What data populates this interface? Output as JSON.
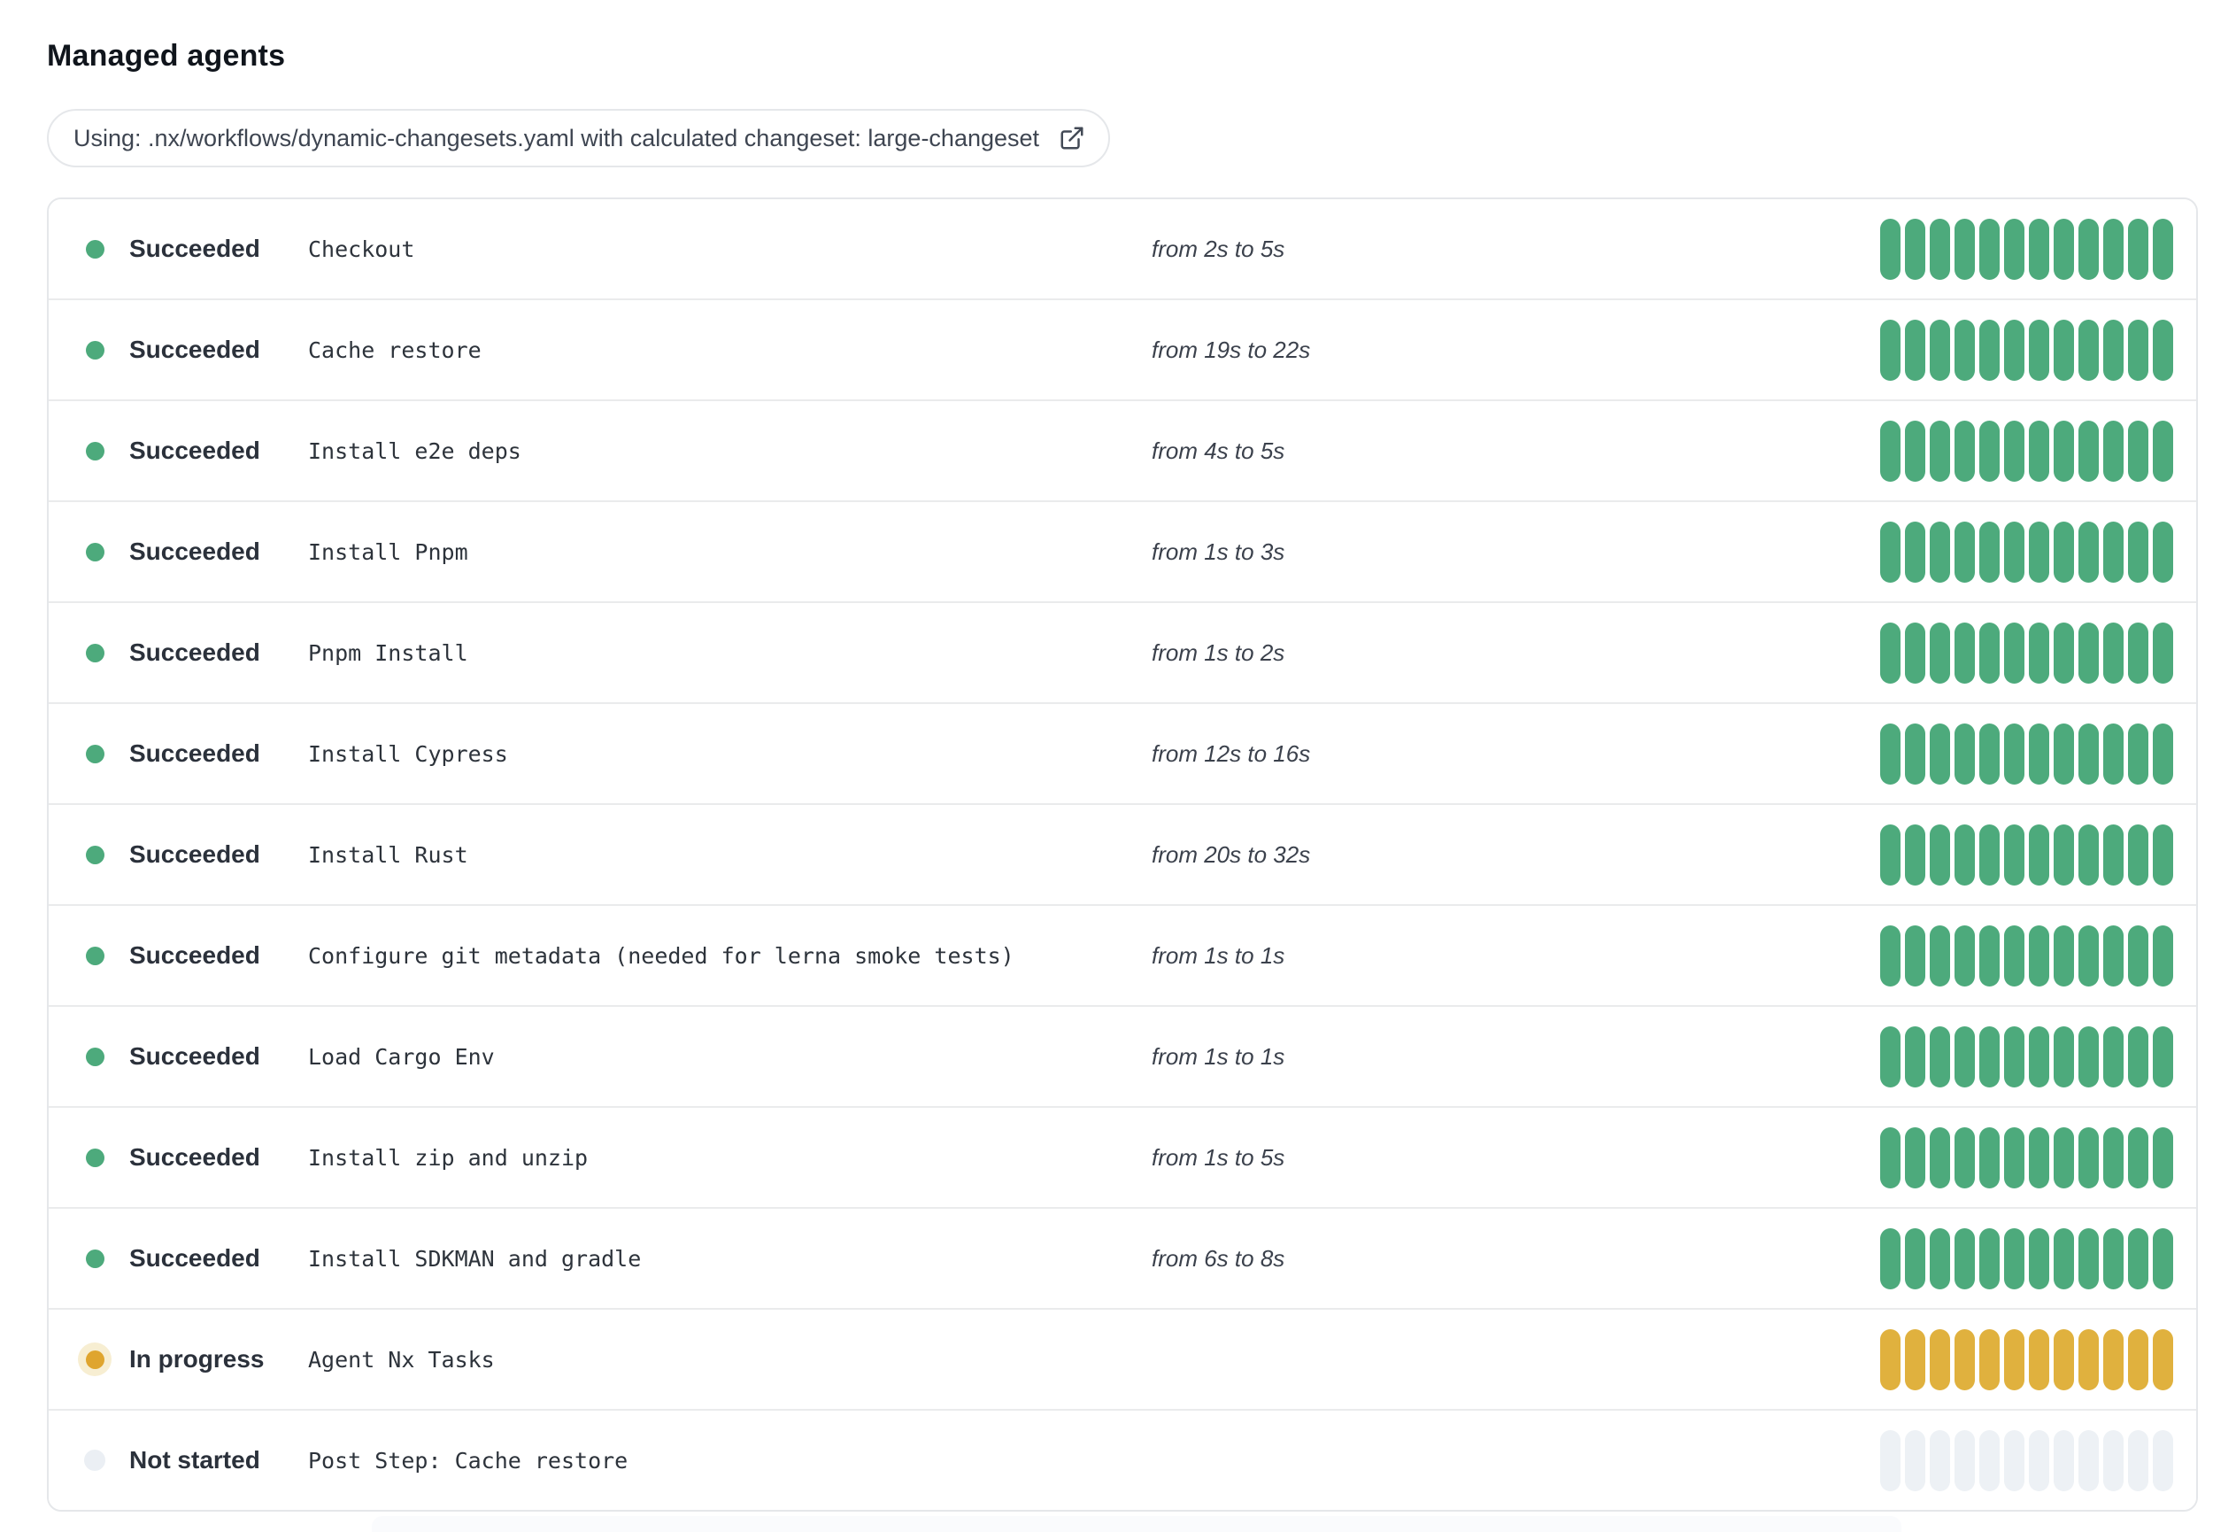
{
  "page": {
    "title": "Managed agents"
  },
  "workflow_banner": {
    "text": "Using: .nx/workflows/dynamic-changesets.yaml with calculated changeset: large-changeset",
    "icon": "external-link-icon"
  },
  "colors": {
    "succeeded": "#4daa7c",
    "in_progress_bar": "#e0b13e",
    "in_progress_dot": "#dfa52f",
    "in_progress_halo": "#f7eed2",
    "not_started_bar": "#edf1f5",
    "not_started_dot": "#ebeff4",
    "border": "#e5e7ea"
  },
  "agents": {
    "bar_count": 12,
    "rows": [
      {
        "status": "succeeded",
        "status_label": "Succeeded",
        "step": "Checkout",
        "duration": "from 2s to 5s"
      },
      {
        "status": "succeeded",
        "status_label": "Succeeded",
        "step": "Cache restore",
        "duration": "from 19s to 22s"
      },
      {
        "status": "succeeded",
        "status_label": "Succeeded",
        "step": "Install e2e deps",
        "duration": "from 4s to 5s"
      },
      {
        "status": "succeeded",
        "status_label": "Succeeded",
        "step": "Install Pnpm",
        "duration": "from 1s to 3s"
      },
      {
        "status": "succeeded",
        "status_label": "Succeeded",
        "step": "Pnpm Install",
        "duration": "from 1s to 2s"
      },
      {
        "status": "succeeded",
        "status_label": "Succeeded",
        "step": "Install Cypress",
        "duration": "from 12s to 16s"
      },
      {
        "status": "succeeded",
        "status_label": "Succeeded",
        "step": "Install Rust",
        "duration": "from 20s to 32s"
      },
      {
        "status": "succeeded",
        "status_label": "Succeeded",
        "step": "Configure git metadata (needed for lerna smoke tests)",
        "duration": "from 1s to 1s"
      },
      {
        "status": "succeeded",
        "status_label": "Succeeded",
        "step": "Load Cargo Env",
        "duration": "from 1s to 1s"
      },
      {
        "status": "succeeded",
        "status_label": "Succeeded",
        "step": "Install zip and unzip",
        "duration": "from 1s to 5s"
      },
      {
        "status": "succeeded",
        "status_label": "Succeeded",
        "step": "Install SDKMAN and gradle",
        "duration": "from 6s to 8s"
      },
      {
        "status": "in-progress",
        "status_label": "In progress",
        "step": "Agent Nx Tasks",
        "duration": ""
      },
      {
        "status": "not-started",
        "status_label": "Not started",
        "step": "Post Step: Cache restore",
        "duration": ""
      }
    ]
  }
}
